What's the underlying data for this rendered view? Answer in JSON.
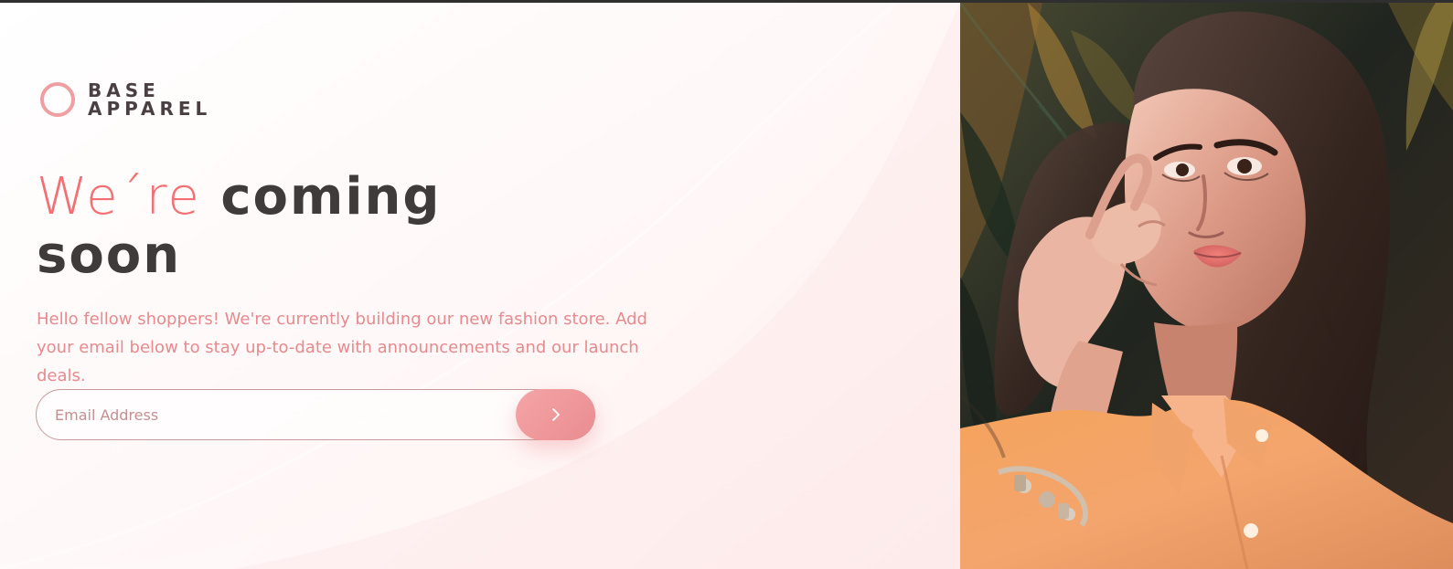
{
  "brand": {
    "line1": "BASE",
    "line2": "APPAREL"
  },
  "hero": {
    "accent": "We´re",
    "title_rest": "coming",
    "title_line2": "soon",
    "description": "Hello fellow shoppers! We're currently building our new fashion store. Add your email below to stay up-to-date with announcements and our launch deals."
  },
  "form": {
    "email_placeholder": "Email Address",
    "submit_icon": "chevron-right-icon"
  },
  "colors": {
    "accent": "#f46f73",
    "brand_text": "#4a3f42",
    "description_text": "#e88a8e",
    "button_start": "#f5a5a7",
    "button_end": "#e98c90",
    "photo_shirt": "#f6a56b"
  },
  "icons": {
    "logo": "ring-logo-icon",
    "submit": "chevron-right-icon"
  }
}
